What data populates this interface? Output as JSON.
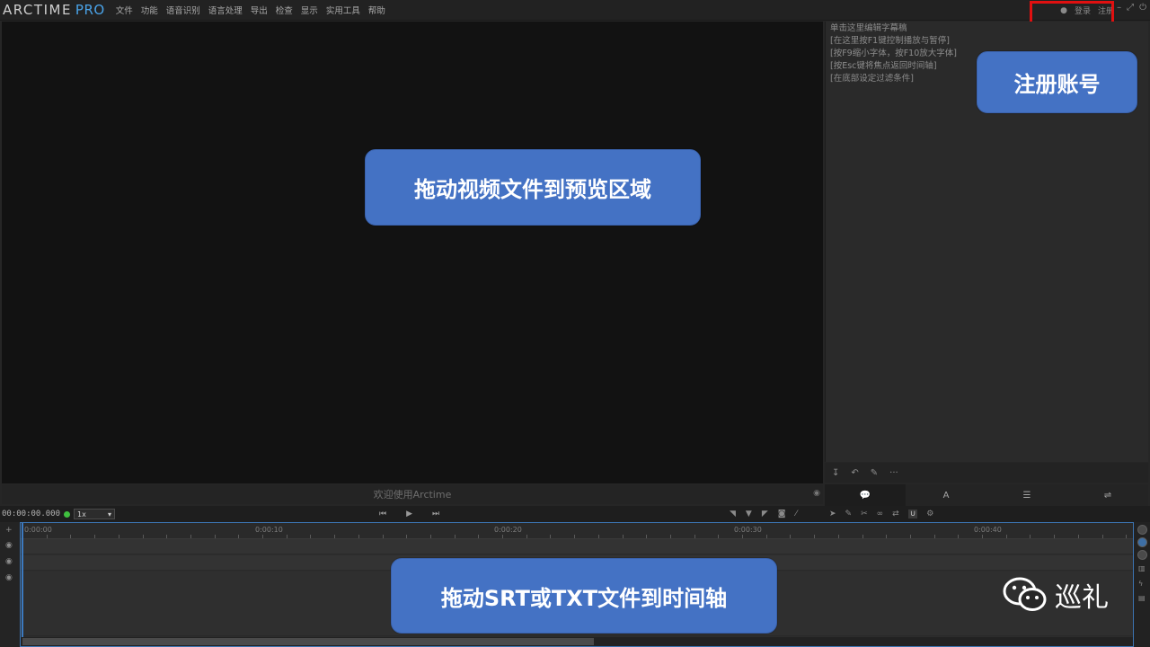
{
  "app": {
    "logo_main": "ARCTIME",
    "logo_pro": "PRO",
    "menu": [
      "文件",
      "功能",
      "语音识别",
      "语言处理",
      "导出",
      "检查",
      "显示",
      "实用工具",
      "帮助"
    ],
    "account": {
      "login": "登录",
      "register": "注册"
    }
  },
  "preview": {
    "status_text": "欢迎使用Arctime"
  },
  "editor": {
    "hints": [
      "单击这里编辑字幕稿",
      "[在这里按F1键控制播放与暂停]",
      "[按F9缩小字体，按F10放大字体]",
      "[按Esc键将焦点返回时间轴]",
      "[在底部设定过滤条件]"
    ],
    "tabs": [
      "💬",
      "A",
      "☰",
      "⇌"
    ]
  },
  "transport": {
    "timecode": "00:00:00.000",
    "speed": "1x"
  },
  "timeline": {
    "ticks": [
      "0:00:00",
      "0:00:10",
      "0:00:20",
      "0:00:30",
      "0:00:40"
    ]
  },
  "callouts": {
    "drag_video": "拖动视频文件到预览区域",
    "register_account": "注册账号",
    "drag_srt": "拖动SRT或TXT文件到时间轴"
  },
  "watermark": {
    "text": "巡礼"
  },
  "colors": {
    "accent": "#4aa3e8",
    "callout": "#4472c4",
    "highlight_box": "#e01010",
    "timeline_border": "#3b73b0"
  }
}
